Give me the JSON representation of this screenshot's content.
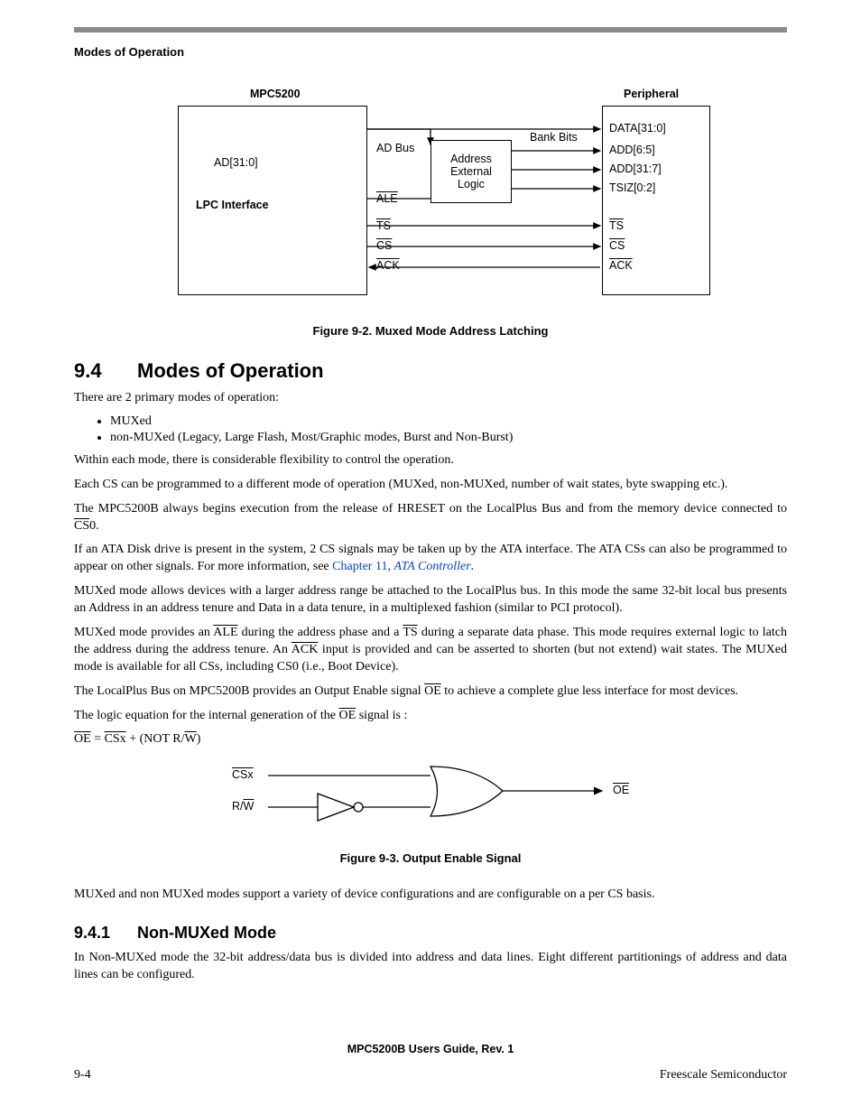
{
  "header": {
    "running": "Modes of Operation"
  },
  "fig1": {
    "mpc_title": "MPC5200",
    "periph_title": "Peripheral",
    "ad_bus": "AD[31:0]",
    "lpc": "LPC Interface",
    "ad_bus_lbl": "AD Bus",
    "bank_bits": "Bank Bits",
    "addr_ext_logic_l1": "Address",
    "addr_ext_logic_l2": "External",
    "addr_ext_logic_l3": "Logic",
    "ale": "ALE",
    "ts": "TS",
    "cs": "CS",
    "ack": "ACK",
    "data_bus": "DATA[31:0]",
    "add65": "ADD[6:5]",
    "add317": "ADD[31:7]",
    "tsiz": "TSIZ[0:2]",
    "caption": "Figure 9-2. Muxed Mode Address Latching"
  },
  "section94": {
    "num": "9.4",
    "title": "Modes of Operation",
    "intro": "There are 2 primary modes of operation:",
    "bul1": "MUXed",
    "bul2": "non-MUXed (Legacy, Large Flash, Most/Graphic modes, Burst and Non-Burst)",
    "p_within": "Within each mode, there is considerable flexibility to control the operation.",
    "p_eachcs": "Each CS can be programmed to a different mode of operation (MUXed, non-MUXed, number of wait states, byte swapping etc.).",
    "p_cs0_a": "The MPC5200B always begins execution from the release of HRESET on the LocalPlus Bus and from the memory device connected to ",
    "p_cs0_sig": "CS",
    "p_cs0_b": "0.",
    "p_ata_a": "If an ATA Disk drive is present in the system, 2 CS signals may be taken up by the ATA interface. The ATA CSs can also be programmed to appear on other signals. For more information, see ",
    "p_ata_link1": "Chapter 11, ",
    "p_ata_link2": "ATA Controller",
    "p_ata_b": ".",
    "p_muxed_range": "MUXed mode allows devices with a larger address range be attached to the LocalPlus bus. In this mode the same 32-bit local bus presents an Address in an address tenure and Data in a data tenure, in a multiplexed fashion (similar to PCI protocol).",
    "p_mux2_a": "MUXed mode provides an ",
    "p_mux2_ale": "ALE",
    "p_mux2_b": " during the address phase and a ",
    "p_mux2_ts": "TS",
    "p_mux2_c": " during a separate data phase.  This mode requires external logic to latch the address during the address tenure. An ",
    "p_mux2_ack": "ACK",
    "p_mux2_d": " input is provided and can be asserted to shorten (but not extend) wait states. The MUXed mode is available for all CSs, including CS0 (i.e., Boot Device).",
    "p_oe_a": "The LocalPlus Bus on MPC5200B provides an Output Enable signal ",
    "p_oe_sig": "OE",
    "p_oe_b": " to achieve a complete glue less interface for most devices.",
    "p_logic_a": "The logic equation for the internal generation of the ",
    "p_logic_sig": "OE",
    "p_logic_b": " signal is :",
    "eq_oe": "OE",
    "eq_eq": " = ",
    "eq_csx": "CSx",
    "eq_plus": " + (NOT R/",
    "eq_w": "W",
    "eq_end": ")"
  },
  "fig2": {
    "csx": "CSx",
    "rw_pre": "R/",
    "rw_w": "W",
    "oe": "OE",
    "caption": "Figure 9-3. Output Enable Signal"
  },
  "p_after_fig2": "MUXed and non MUXed modes support a variety of device configurations and are configurable on a per CS basis.",
  "section941": {
    "num": "9.4.1",
    "title": "Non-MUXed Mode",
    "p": "In Non-MUXed mode the 32-bit address/data bus is divided into address and data lines. Eight different partitionings of address and data lines can be configured."
  },
  "footer": {
    "center": "MPC5200B Users Guide, Rev. 1",
    "left": "9-4",
    "right": "Freescale Semiconductor"
  }
}
